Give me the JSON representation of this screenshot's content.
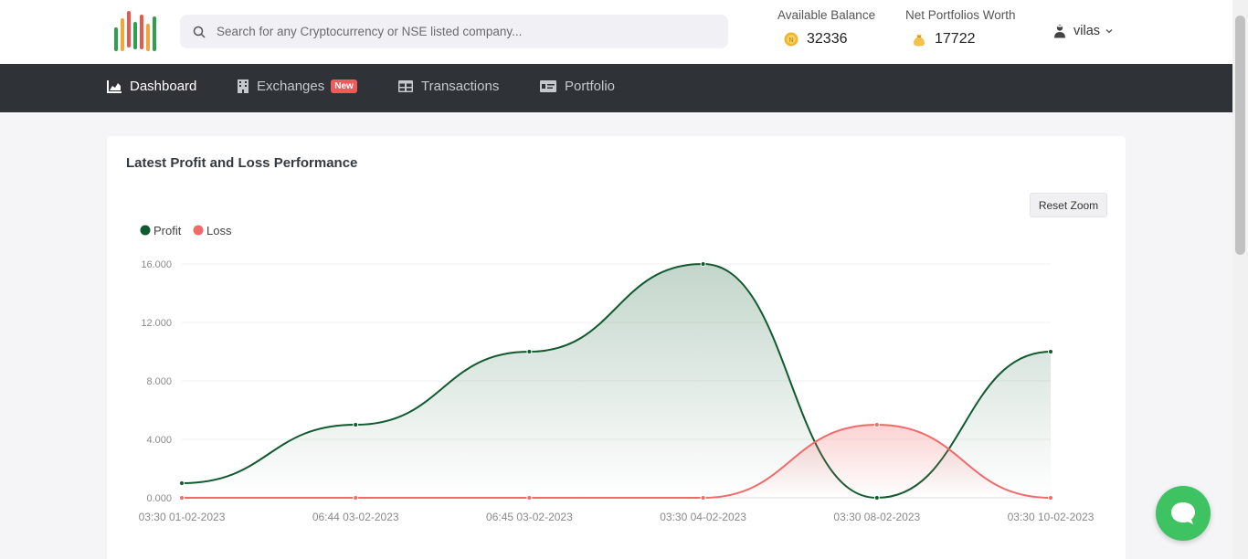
{
  "search": {
    "placeholder": "Search for any Cryptocurrency or NSE listed company..."
  },
  "balance": {
    "available_label": "Available Balance",
    "available_value": "32336",
    "net_label": "Net Portfolios Worth",
    "net_value": "17722"
  },
  "user": {
    "name": "vilas"
  },
  "nav": {
    "dashboard": "Dashboard",
    "exchanges": "Exchanges",
    "exchanges_badge": "New",
    "transactions": "Transactions",
    "portfolio": "Portfolio"
  },
  "card": {
    "title": "Latest Profit and Loss Performance",
    "reset_zoom": "Reset Zoom"
  },
  "colors": {
    "profit": "#0f5a2e",
    "loss": "#f06a6a",
    "navbar": "#2f3237",
    "chat": "#3ec262"
  },
  "chart_data": {
    "type": "area",
    "categories": [
      "03:30 01-02-2023",
      "06:44 03-02-2023",
      "06:45 03-02-2023",
      "03:30 04-02-2023",
      "03:30 08-02-2023",
      "03:30 10-02-2023"
    ],
    "series": [
      {
        "name": "Profit",
        "values": [
          1000,
          5000,
          10000,
          16000,
          0,
          10000
        ]
      },
      {
        "name": "Loss",
        "values": [
          0,
          0,
          0,
          0,
          5000,
          0
        ]
      }
    ],
    "ylim": [
      0,
      16000
    ],
    "yticks": [
      "0.000",
      "4.000",
      "8.000",
      "12.000",
      "16.000"
    ],
    "legend": "top-left",
    "grid": true
  }
}
